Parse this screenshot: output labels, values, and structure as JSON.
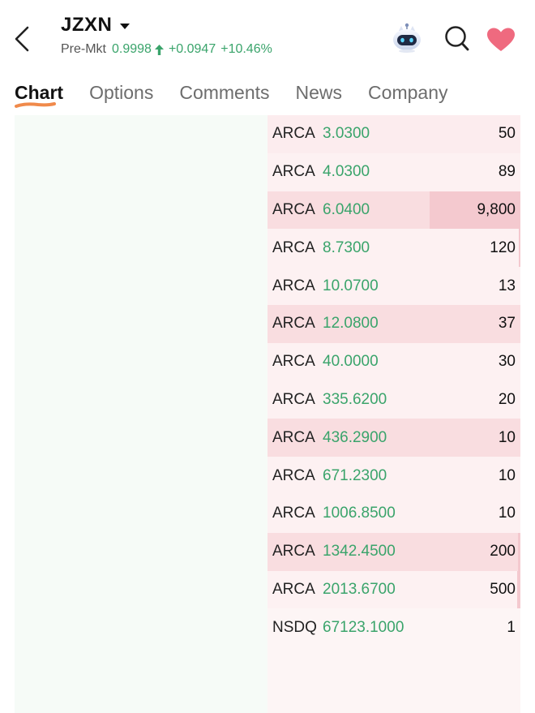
{
  "header": {
    "ticker": "JZXN",
    "pre_mkt_label": "Pre-Mkt",
    "price": "0.9998",
    "change": "+0.0947",
    "change_pct": "+10.46%"
  },
  "tabs": [
    {
      "label": "Chart",
      "active": true
    },
    {
      "label": "Options",
      "active": false
    },
    {
      "label": "Comments",
      "active": false
    },
    {
      "label": "News",
      "active": false
    },
    {
      "label": "Company",
      "active": false
    }
  ],
  "icons": {
    "back": "back-arrow-icon",
    "ticker_dropdown": "caret-down-icon",
    "assistant": "robot-assistant-icon",
    "search": "search-icon",
    "favorite": "heart-icon"
  },
  "colors": {
    "up_green": "#3aa46b",
    "bid_panel_bg": "#f6fbf7",
    "ask_panel_bg": "#fdf5f5",
    "ask_bar": "#f4c9cf",
    "heart": "#ef6a7f"
  },
  "asks": [
    {
      "exchange": "ARCA",
      "price": "3.0300",
      "size": "50"
    },
    {
      "exchange": "ARCA",
      "price": "4.0300",
      "size": "89"
    },
    {
      "exchange": "ARCA",
      "price": "6.0400",
      "size": "9,800"
    },
    {
      "exchange": "ARCA",
      "price": "8.7300",
      "size": "120"
    },
    {
      "exchange": "ARCA",
      "price": "10.0700",
      "size": "13"
    },
    {
      "exchange": "ARCA",
      "price": "12.0800",
      "size": "37"
    },
    {
      "exchange": "ARCA",
      "price": "40.0000",
      "size": "30"
    },
    {
      "exchange": "ARCA",
      "price": "335.6200",
      "size": "20"
    },
    {
      "exchange": "ARCA",
      "price": "436.2900",
      "size": "10"
    },
    {
      "exchange": "ARCA",
      "price": "671.2300",
      "size": "10"
    },
    {
      "exchange": "ARCA",
      "price": "1006.8500",
      "size": "10"
    },
    {
      "exchange": "ARCA",
      "price": "1342.4500",
      "size": "200"
    },
    {
      "exchange": "ARCA",
      "price": "2013.6700",
      "size": "500"
    },
    {
      "exchange": "NSDQ",
      "price": "67123.1000",
      "size": "1"
    }
  ]
}
